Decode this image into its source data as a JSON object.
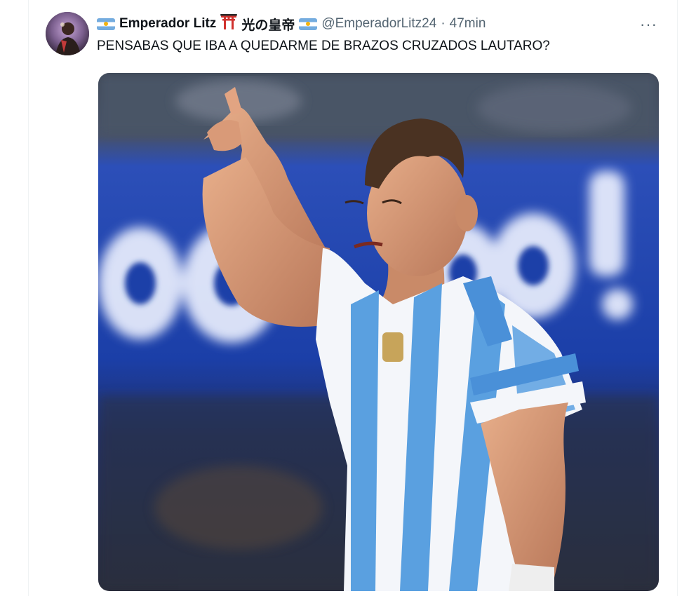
{
  "tweet": {
    "display_name": "Emperador Litz",
    "name_suffix": "光の皇帝",
    "handle": "@EmperadorLitz24",
    "separator": "·",
    "time": "47min",
    "more_label": "···",
    "text": "PENSABAS QUE IBA A QUEDARME DE BRAZOS CRUZADOS LAUTARO?"
  },
  "media": {
    "description_icon": "photo-of-football-player-pointing-upward",
    "banner_text": "GOOOOOOL"
  },
  "colors": {
    "text_primary": "#0f1419",
    "text_secondary": "#536471",
    "argentina_blue": "#74acdf",
    "stadium_blue": "#1b3fa8"
  }
}
